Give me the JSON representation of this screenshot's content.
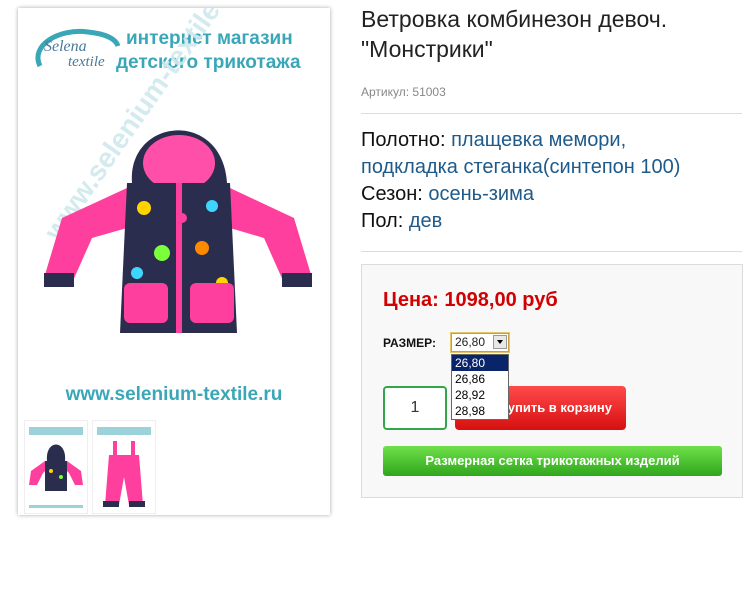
{
  "product": {
    "title": "Ветровка комбинезон девоч. \"Монстрики\"",
    "sku": "Артикул: 51003",
    "props": [
      {
        "label": "Полотно:",
        "value": "плащевка мемори,"
      },
      {
        "label": "",
        "value": "подкладка стеганка(синтепон 100)"
      },
      {
        "label": "Сезон:",
        "value": "осень-зима"
      },
      {
        "label": "Пол:",
        "value": "дев"
      }
    ]
  },
  "image": {
    "logo_line1": "Selena",
    "logo_line2": "textile",
    "shop_line1": "интернет магазин",
    "shop_line2": "детского трикотажа",
    "watermark": "www.selenium-textile.ru",
    "url": "www.selenium-textile.ru"
  },
  "buy": {
    "price": "Цена: 1098,00 руб",
    "size_label": "РАЗМЕР:",
    "size_selected": "26,80",
    "size_options": [
      "26,80",
      "26,86",
      "28,92",
      "28,98"
    ],
    "qty": "1",
    "cart_button": "Купить в корзину",
    "size_chart_button": "Размерная сетка трикотажных изделий"
  },
  "colors": {
    "price": "#d20000",
    "accent": "#3aa7b8",
    "link": "#1e5a8a",
    "green": "#33a64b",
    "red": "#d61010"
  }
}
